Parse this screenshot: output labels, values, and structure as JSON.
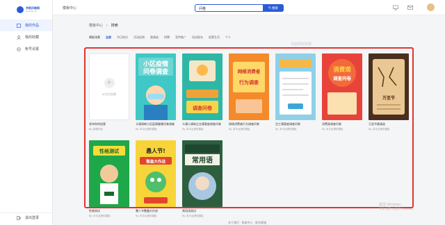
{
  "sidebar": {
    "logo_title": "并航问卷网",
    "logo_sub": "wenjuan.net",
    "items": [
      {
        "label": "我的作品",
        "icon": "layers-icon"
      },
      {
        "label": "我的收藏",
        "icon": "user-icon"
      },
      {
        "label": "帐号设置",
        "icon": "settings-icon"
      }
    ],
    "logout": "退出登录"
  },
  "header": {
    "title": "模板中心",
    "search_value": "问卷",
    "search_button": "搜索"
  },
  "breadcrumb": {
    "root": "模板中心",
    "current": "搜索"
  },
  "filters": {
    "label": "模板场景",
    "items": [
      "全部",
      "节日热点",
      "活动促销",
      "邀请函",
      "招聘",
      "宣传推广",
      "培训报名",
      "经营生活",
      "个人"
    ],
    "active": "全部"
  },
  "templates": [
    {
      "title": "发布你的创意",
      "meta": "By: 新建作品",
      "kind": "create",
      "create_label": "从空白创建"
    },
    {
      "title": "卡通清新小区疫情健康问卷调查",
      "meta": "By: 本平台提供模板",
      "thumb_text": "小区疫情问卷调查"
    },
    {
      "title": "卡通小清新企业满意度调查问卷",
      "meta": "By: 本平台提供模板",
      "thumb_text": "客户满意度调查问卷"
    },
    {
      "title": "网络消费者行为调查问卷",
      "meta": "By: 本平台提供模板",
      "thumb_text": "网络消费者行为调查"
    },
    {
      "title": "员工满意度调查问卷",
      "meta": "By: 本平台提供模板",
      "thumb_text": "员工满意度调查问卷"
    },
    {
      "title": "消费观调查问卷",
      "meta": "By: 本平台提供模板",
      "thumb_text": "大学生消费观调查问卷"
    },
    {
      "title": "万圣节邀请函",
      "meta": "By: 本平台提供模板",
      "thumb_text": "万圣节"
    },
    {
      "title": "性格测试",
      "meta": "By: 本平台提供模板",
      "thumb_text": "性格测试"
    },
    {
      "title": "愚人节整蛊大作战",
      "meta": "By: 本平台提供模板",
      "thumb_text": "愚人节!整蛊大作战"
    },
    {
      "title": "常用语测试",
      "meta": "By: 本平台提供模板",
      "thumb_text": "常用语"
    }
  ],
  "watermarks": [
    "页面预览效果",
    "激活 Windows",
    "转到\"设置\"以激活 Windows。"
  ],
  "footer": "关于我们 · 帮助中心 · 联系客服"
}
